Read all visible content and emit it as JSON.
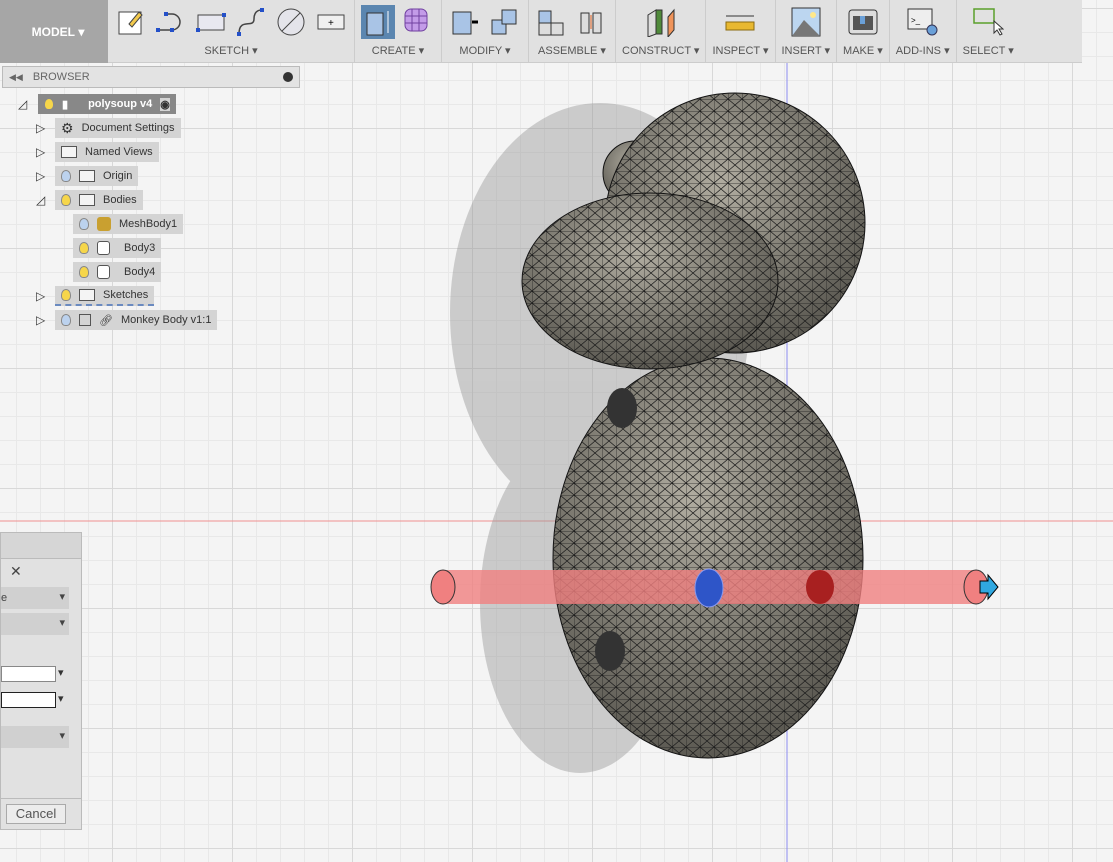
{
  "toolbar": {
    "workspace": "MODEL",
    "groups": [
      {
        "label": "SKETCH"
      },
      {
        "label": "CREATE"
      },
      {
        "label": "MODIFY"
      },
      {
        "label": "ASSEMBLE"
      },
      {
        "label": "CONSTRUCT"
      },
      {
        "label": "INSPECT"
      },
      {
        "label": "INSERT"
      },
      {
        "label": "MAKE"
      },
      {
        "label": "ADD-INS"
      },
      {
        "label": "SELECT"
      }
    ]
  },
  "browser": {
    "title": "BROWSER",
    "items": [
      {
        "label": "polysoup v4",
        "icon": "component-icon"
      },
      {
        "label": "Document Settings",
        "icon": "gear-icon"
      },
      {
        "label": "Named Views",
        "icon": "folder-icon"
      },
      {
        "label": "Origin",
        "icon": "folder-icon"
      },
      {
        "label": "Bodies",
        "icon": "folder-icon"
      },
      {
        "label": "MeshBody1",
        "icon": "mesh-icon"
      },
      {
        "label": "Body3",
        "icon": "body-icon"
      },
      {
        "label": "Body4",
        "icon": "body-icon"
      },
      {
        "label": "Sketches",
        "icon": "folder-icon"
      },
      {
        "label": "Monkey Body v1:1",
        "icon": "link-icon"
      }
    ]
  },
  "dialog": {
    "option1": "e",
    "cancel": "Cancel"
  },
  "colors": {
    "accent": "#5b86b0",
    "mesh": "#7a776e",
    "cylinder": "#f08080"
  }
}
